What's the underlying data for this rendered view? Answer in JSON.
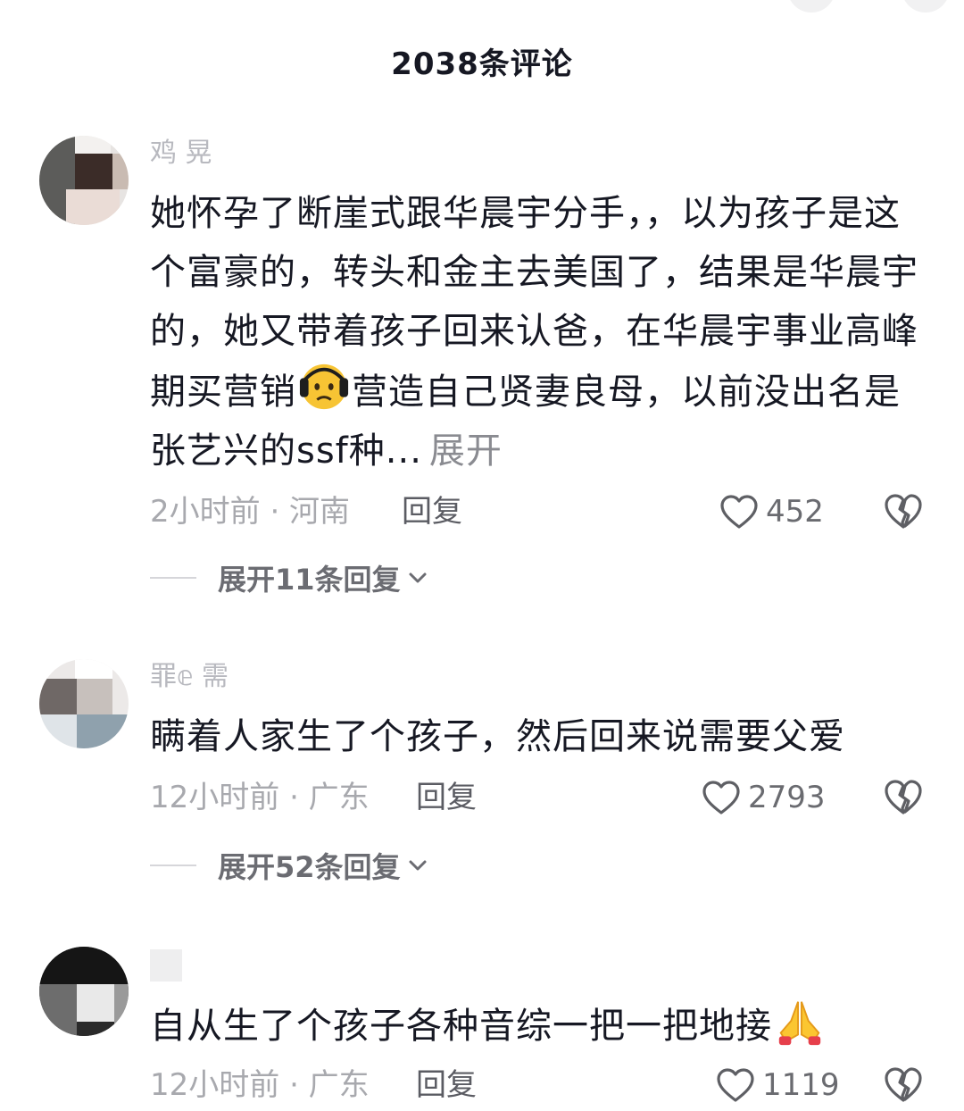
{
  "header": {
    "title": "2038条评论"
  },
  "comments": [
    {
      "username": "鸡    晃",
      "content": "她怀孕了断崖式跟华晨宇分手，，以为孩子是这个富豪的，转头和金主去美国了，结果是华晨宇的，她又带着孩子回来认爸，在华晨宇事业高峰期买营销",
      "content_tail": "营造自己贤妻良母，以前没出名是张艺兴的ssf种...",
      "more_label": "展开",
      "time_location": "2小时前 · 河南",
      "reply_label": "回复",
      "likes": "452",
      "expand_label": "展开11条回复",
      "icons": {
        "like": "heart-outline-icon",
        "dislike": "broken-heart-icon",
        "emoji": "sad-face-emoji"
      }
    },
    {
      "username": "罪𝕖  需",
      "content": "瞒着人家生了个孩子，然后回来说需要父爱",
      "time_location": "12小时前 · 广东",
      "reply_label": "回复",
      "likes": "2793",
      "expand_label": "展开52条回复"
    },
    {
      "username": "",
      "content": "自从生了个孩子各种音综一把一把地接",
      "time_location": "12小时前 · 广东",
      "reply_label": "回复",
      "likes": "1119",
      "icons": {
        "emoji": "praying-hands-emoji"
      }
    }
  ],
  "colors": {
    "text_primary": "#161823",
    "text_secondary": "#a8a9ae",
    "reply": "#5b5c63",
    "emoji_yellow": "#f7c434"
  }
}
